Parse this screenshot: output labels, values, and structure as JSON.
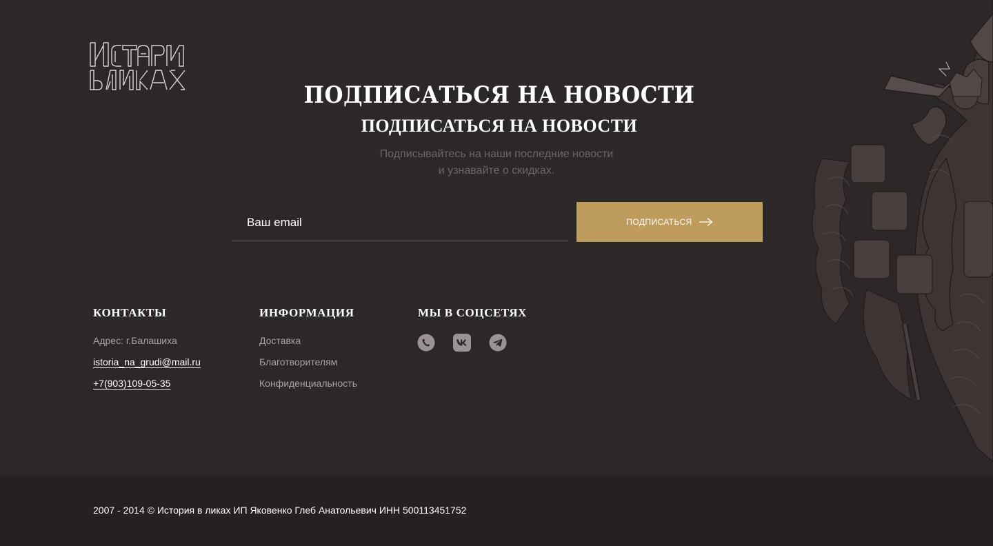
{
  "logo": {
    "text": "История в ликах",
    "alt": "История в ликах"
  },
  "subscribe": {
    "title": "Подписаться на новости",
    "subtitle": "Подписаться на новости",
    "description_line1": "Подписывайтесь на наши последние новости",
    "description_line2": "и узнавайте о скидках.",
    "email_placeholder": "Ваш email",
    "email_value": "",
    "button_label": "ПОДПИСАТЬСЯ",
    "button_icon": "arrow-right-icon",
    "accent_color": "#bd9c5e"
  },
  "contacts": {
    "heading": "Контакты",
    "address": "Адрес: г.Балашиха",
    "email": "istoria_na_grudi@mail.ru",
    "phone": "+7(903)109-05-35"
  },
  "info": {
    "heading": "Информация",
    "links": [
      "Доставка",
      "Благотворителям",
      "Конфиденциальность"
    ]
  },
  "social": {
    "heading": "Мы в соцсетях",
    "icons": [
      "whatsapp-icon",
      "vk-icon",
      "telegram-icon"
    ]
  },
  "footer": {
    "copyright": "2007 - 2014 © История в ликах ИП Яковенко Глеб Анатольевич ИНН 500113451752"
  },
  "colors": {
    "background": "#2d2828",
    "bottom_bar": "#262121",
    "muted_text": "#a8a2a2",
    "button": "#bd9c5e"
  }
}
